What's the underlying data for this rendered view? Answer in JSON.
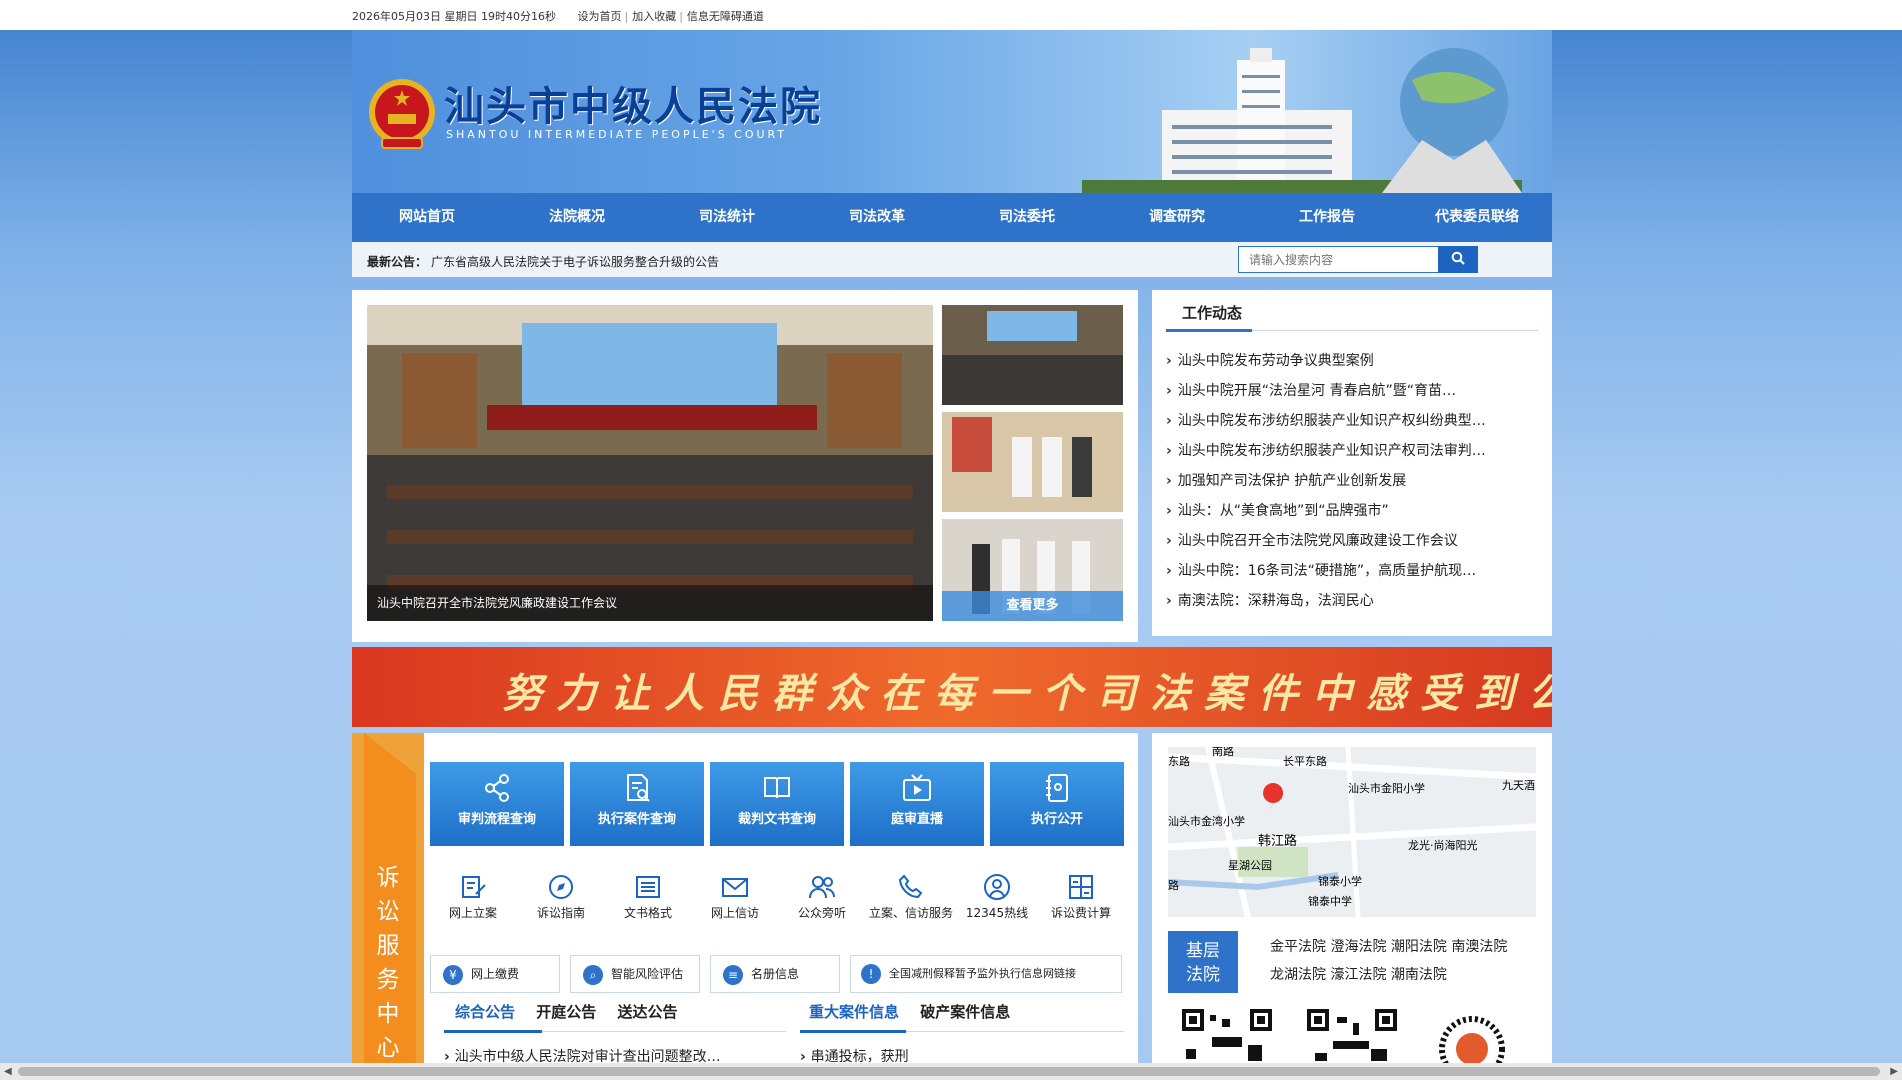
{
  "topbar": {
    "datetime": "2026年05月03日  星期日  19时40分16秒",
    "set_home": "设为首页",
    "bookmark": "加入收藏",
    "accessible": "信息无障碍通道"
  },
  "header": {
    "title_cn": "汕头市中级人民法院",
    "title_en": "SHANTOU INTERMEDIATE PEOPLE'S COURT"
  },
  "nav": [
    "网站首页",
    "法院概况",
    "司法统计",
    "司法改革",
    "司法委托",
    "调查研究",
    "工作报告",
    "代表委员联络"
  ],
  "notice": {
    "label": "最新公告：",
    "text": "广东省高级人民法院关于电子诉讼服务整合升级的公告"
  },
  "search": {
    "placeholder": "请输入搜索内容",
    "icon": "search-icon"
  },
  "slideshow": {
    "caption": "汕头中院召开全市法院党风廉政建设工作会议",
    "more": "查看更多"
  },
  "work_news": {
    "title": "工作动态",
    "items": [
      "汕头中院发布劳动争议典型案例",
      "汕头中院开展“法治星河 青春启航”暨“育苗…",
      "汕头中院发布涉纺织服装产业知识产权纠纷典型…",
      "汕头中院发布涉纺织服装产业知识产权司法审判…",
      "加强知产司法保护 护航产业创新发展",
      "汕头：从“美食高地”到“品牌强市”",
      "汕头中院召开全市法院党风廉政建设工作会议",
      "汕头中院：16条司法“硬措施”，高质量护航现…",
      "南澳法院：深耕海岛，法润民心"
    ]
  },
  "slogan": "努力让人民群众在每一个司法案件中感受到公平正义",
  "service": {
    "tag": "诉讼服务中心",
    "big_buttons": [
      {
        "label": "审判流程查询",
        "icon": "share-icon"
      },
      {
        "label": "执行案件查询",
        "icon": "document-search-icon"
      },
      {
        "label": "裁判文书查询",
        "icon": "book-icon"
      },
      {
        "label": "庭审直播",
        "icon": "tv-play-icon"
      },
      {
        "label": "执行公开",
        "icon": "notebook-icon"
      }
    ],
    "small_icons": [
      {
        "label": "网上立案",
        "icon": "edit-document-icon"
      },
      {
        "label": "诉讼指南",
        "icon": "compass-icon"
      },
      {
        "label": "文书格式",
        "icon": "list-icon"
      },
      {
        "label": "网上信访",
        "icon": "mail-icon"
      },
      {
        "label": "公众旁听",
        "icon": "people-icon"
      },
      {
        "label": "立案、信访服务",
        "icon": "phone-icon"
      },
      {
        "label": "12345热线",
        "icon": "user-circle-icon"
      },
      {
        "label": "诉讼费计算",
        "icon": "calculator-icon"
      }
    ],
    "pills": [
      {
        "label": "网上缴费",
        "icon": "yen-icon"
      },
      {
        "label": "智能风险评估",
        "icon": "magnifier-icon"
      },
      {
        "label": "名册信息",
        "icon": "roster-icon"
      },
      {
        "label": "全国减刑假释暂予监外执行信息网链接",
        "icon": "shield-icon"
      }
    ],
    "tabs_left": [
      "综合公告",
      "开庭公告",
      "送达公告"
    ],
    "tabs_right": [
      "重大案件信息",
      "破产案件信息"
    ],
    "left_item": "汕头市中级人民法院对审计查出问题整改…",
    "right_item": "串通投标，获刑"
  },
  "map": {
    "labels": [
      "东路",
      "南路",
      "长平东路",
      "汕头市金阳小学",
      "九天酒",
      "汕头市金湾小学",
      "韩江路",
      "星湖公园",
      "龙光·尚海阳光",
      "锦泰小学",
      "锦泰中学",
      "路"
    ]
  },
  "courts": {
    "label": "基层法院",
    "items": [
      "金平法院",
      "澄海法院",
      "潮阳法院",
      "南澳法院",
      "龙湖法院",
      "濠江法院",
      "潮南法院"
    ]
  },
  "colors": {
    "nav": "#2e73c9",
    "accent": "#1d64c0",
    "service_tag": "#f28d1e",
    "slogan": "#e04a22"
  }
}
